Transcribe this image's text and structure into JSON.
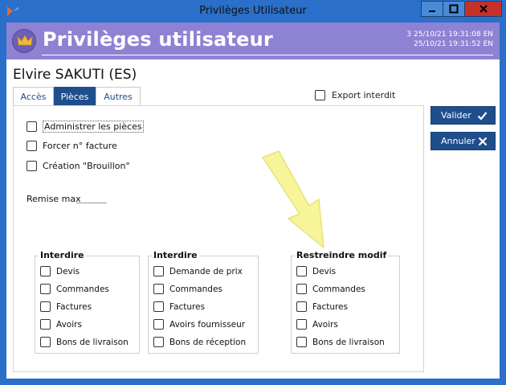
{
  "window": {
    "title": "Privilèges Utilisateur"
  },
  "banner": {
    "title": "Privilèges utilisateur",
    "info_line1": "3  25/10/21 19:31:08  EN",
    "info_line2": "25/10/21 19:31:52  EN",
    "color": "#8e82d3"
  },
  "user": {
    "name": "Elvire SAKUTI (ES)"
  },
  "tabs": [
    {
      "label": "Accès",
      "active": false
    },
    {
      "label": "Pièces",
      "active": true
    },
    {
      "label": "Autres",
      "active": false
    }
  ],
  "export": {
    "label": "Export interdit",
    "checked": false
  },
  "options": [
    {
      "label": "Administrer les pièces",
      "checked": false
    },
    {
      "label": "Forcer n° facture",
      "checked": false
    },
    {
      "label": "Création \"Brouillon\"",
      "checked": false
    }
  ],
  "remise": {
    "label": "Remise max",
    "value": ""
  },
  "groups": [
    {
      "title": "Interdire",
      "items": [
        "Devis",
        "Commandes",
        "Factures",
        "Avoirs",
        "Bons de livraison"
      ]
    },
    {
      "title": "Interdire",
      "items": [
        "Demande de prix",
        "Commandes",
        "Factures",
        "Avoirs fournisseur",
        "Bons de réception"
      ]
    },
    {
      "title": "Restreindre modif",
      "items": [
        "Devis",
        "Commandes",
        "Factures",
        "Avoirs",
        "Bons de livraison"
      ]
    }
  ],
  "buttons": {
    "validate": "Valider",
    "cancel": "Annuler"
  },
  "icons": {
    "app": "app-logo-icon",
    "crown": "crown-icon",
    "check": "check-icon",
    "close": "close-icon",
    "arrow": "pointer-arrow-icon"
  },
  "colors": {
    "accent": "#1f4e8c",
    "titlebar": "#2a6fc9",
    "close": "#c7312a",
    "arrow": "#f7f59a"
  }
}
